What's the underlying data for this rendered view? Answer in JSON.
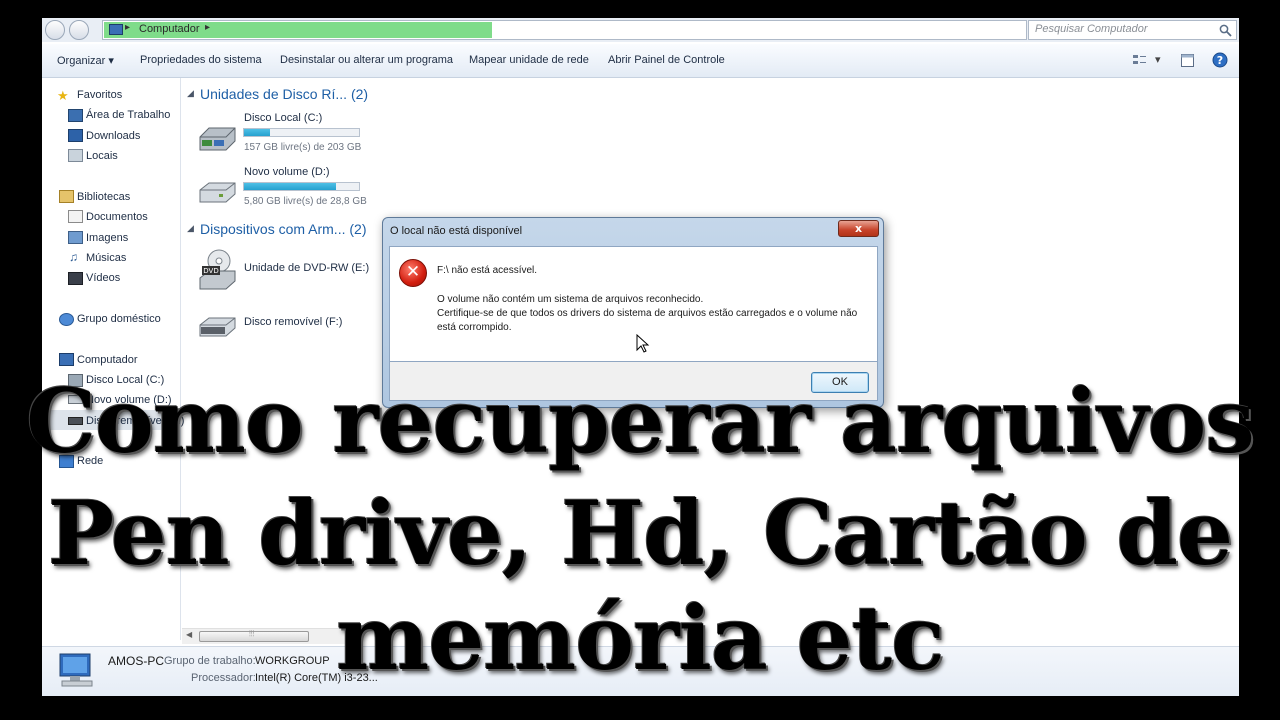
{
  "address_bar": {
    "path": "Computador",
    "search_placeholder": "Pesquisar Computador"
  },
  "toolbar": {
    "organize": "Organizar",
    "items": [
      "Propriedades do sistema",
      "Desinstalar ou alterar um programa",
      "Mapear unidade de rede",
      "Abrir Painel de Controle"
    ]
  },
  "nav": {
    "favorites": "Favoritos",
    "fav_items": [
      "Área de Trabalho",
      "Downloads",
      "Locais"
    ],
    "libraries": "Bibliotecas",
    "lib_items": [
      "Documentos",
      "Imagens",
      "Músicas",
      "Vídeos"
    ],
    "homegroup": "Grupo doméstico",
    "computer": "Computador",
    "comp_items": [
      "Disco Local (C:)",
      "Novo volume (D:)",
      "Disco removível (F:)"
    ],
    "network": "Rede"
  },
  "content": {
    "group_hdd": "Unidades de Disco Rí...",
    "group_hdd_count": "(2)",
    "group_removable": "Dispositivos com Arm...",
    "group_removable_count": "(2)",
    "drives": [
      {
        "name": "Disco Local (C:)",
        "free": "157 GB livre(s) de 203 GB",
        "used_fraction": 0.23
      },
      {
        "name": "Novo volume (D:)",
        "free": "5,80 GB livre(s) de 28,8 GB",
        "used_fraction": 0.8
      }
    ],
    "devices": [
      {
        "name": "Unidade de DVD-RW (E:)",
        "icon_label": "DVD"
      },
      {
        "name": "Disco removível (F:)"
      }
    ]
  },
  "details": {
    "pc_name": "AMOS-PC",
    "workgroup_label": "Grupo de trabalho:",
    "workgroup_value": "WORKGROUP",
    "processor_label": "Processador:",
    "processor_value": "Intel(R) Core(TM) i3-23..."
  },
  "dialog": {
    "title": "O local não está disponível",
    "close": "x",
    "message_main": "F:\\ não está acessível.",
    "message_line1": "O volume não contém um sistema de arquivos reconhecido.",
    "message_line2": "Certifique-se de que todos os drivers do sistema de arquivos estão carregados e o volume não",
    "message_line3": "está corrompido.",
    "ok": "OK"
  },
  "overlay": {
    "line1": "Como recuperar arquivos",
    "line2": "Pen drive, Hd, Cartão de",
    "line3": "memória etc"
  },
  "colors": {
    "accent_blue": "#1e5fa6",
    "bar_fill": "#26a1cf",
    "error_red": "#d21e0f"
  }
}
